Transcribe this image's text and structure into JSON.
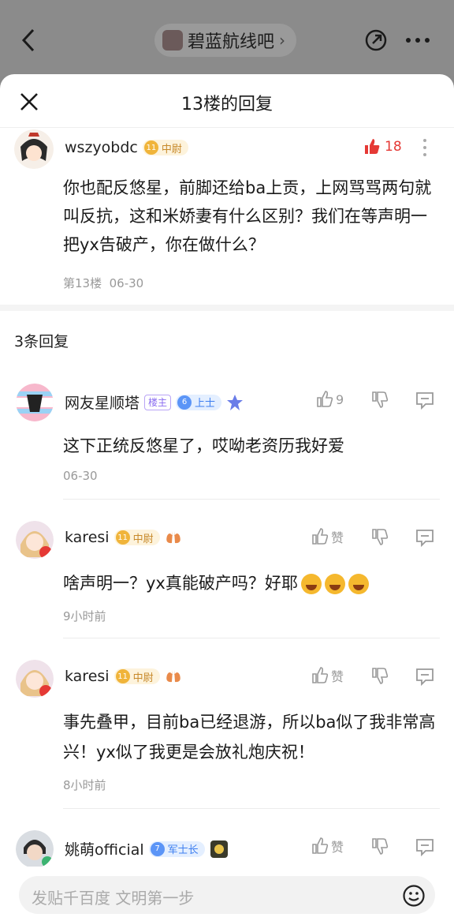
{
  "nav": {
    "forum_name": "碧蓝航线吧",
    "chevron": "›"
  },
  "sheet": {
    "title": "13楼的回复"
  },
  "post": {
    "username": "wszyobdc",
    "level": "11",
    "rank": "中尉",
    "likes": "18",
    "text": "你也配反悠星，前脚还给ba上贡，上网骂骂两句就叫反抗，这和米娇妻有什么区别？我们在等声明一把yx告破产，你在做什么？",
    "floor": "第13楼",
    "date": "06-30"
  },
  "replies_title": "3条回复",
  "replies": [
    {
      "username": "网友星顺塔",
      "owner_badge": "楼主",
      "level": "6",
      "rank": "上士",
      "likes": "9",
      "text": "这下正统反悠星了，哎呦老资历我好爱",
      "time": "06-30"
    },
    {
      "username": "karesi",
      "level": "11",
      "rank": "中尉",
      "likes": "赞",
      "text": "啥声明一？yx真能破产吗？好耶",
      "time": "9小时前"
    },
    {
      "username": "karesi",
      "level": "11",
      "rank": "中尉",
      "likes": "赞",
      "text": "事先叠甲，目前ba已经退游，所以ba似了我非常高兴！yx似了我更是会放礼炮庆祝！",
      "time": "8小时前"
    },
    {
      "username": "姚萌official",
      "level": "7",
      "rank": "军士长",
      "likes": "赞"
    }
  ],
  "input": {
    "placeholder": "发贴千百度 文明第一步"
  },
  "avatar_badge": "神",
  "colors": {
    "like_red": "#e53935",
    "gold_badge": "#f0b43a",
    "blue_badge": "#5b95f7"
  }
}
